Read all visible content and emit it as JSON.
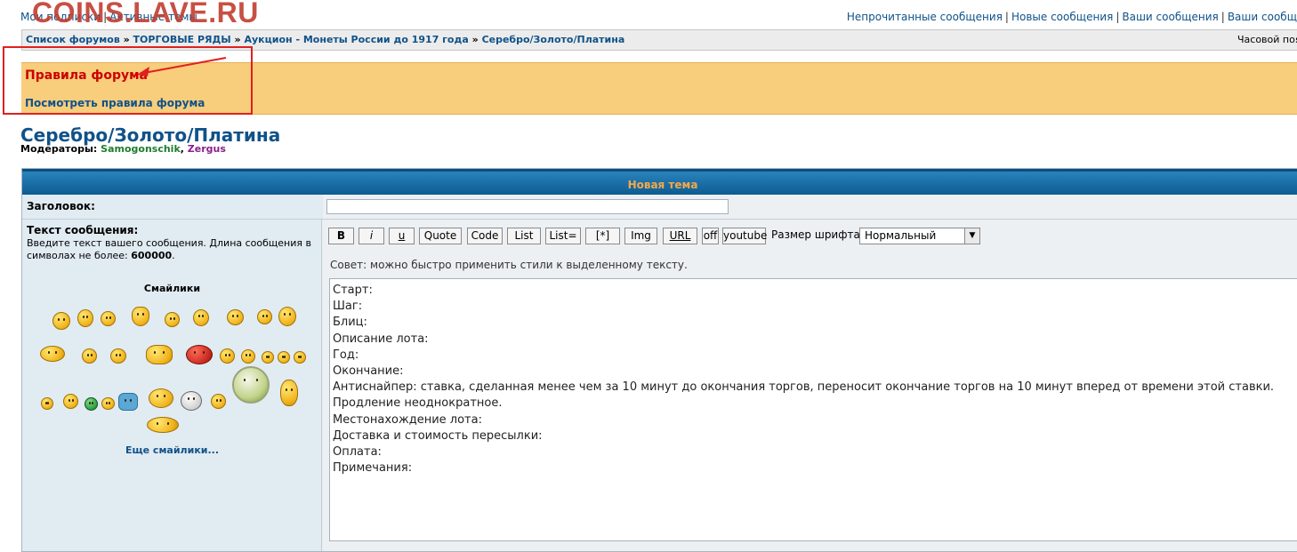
{
  "watermark": "COINS.LAVE.RU",
  "top_left_links": {
    "subscriptions": "Мои подписки",
    "active": "Активные темы"
  },
  "top_right_links": [
    "Непрочитанные сообщения",
    "Новые сообщения",
    "Ваши сообщения",
    "Ваши сообщ"
  ],
  "breadcrumbs": [
    "Список форумов",
    "ТОРГОВЫЕ РЯДЫ",
    "Аукцион - Монеты России до 1917 года",
    "Серебро/Золото/Платина"
  ],
  "timezone_text": "Часовой пояс",
  "rules": {
    "title": "Правила форума",
    "link": "Посмотреть правила форума"
  },
  "forum": {
    "title": "Серебро/Золото/Платина",
    "moderators_label": "Модераторы:",
    "moderators": [
      "Samogonschik",
      "Zergus"
    ]
  },
  "form": {
    "header": "Новая тема",
    "subject_label": "Заголовок:",
    "subject_value": "",
    "message_label": "Текст сообщения:",
    "message_desc": "Введите текст вашего сообщения. Длина сообщения в символах не более: ",
    "message_max": "600000",
    "smilies_title": "Смайлики",
    "more_smilies": "Еще смайлики...",
    "toolbar": [
      "B",
      "i",
      "u",
      "Quote",
      "Code",
      "List",
      "List=",
      "[*]",
      "Img",
      "URL",
      "off",
      "youtube"
    ],
    "font_size_label": "Размер шрифта:",
    "font_size_value": "Нормальный",
    "hint": "Совет: можно быстро применить стили к выделенному тексту.",
    "message_text": "Старт:\nШаг:\nБлиц:\nОписание лота:\nГод:\nОкончание:\nАнтиснайпер: ставка, сделанная менее чем за 10 минут до окончания торгов, переносит окончание торгов на 10 минут вперед от времени этой ставки.\nПродление неоднократное.\nМестонахождение лота:\nДоставка и стоимость пересылки:\nОплата:\nПримечания:"
  },
  "colors": {
    "accent": "#105289",
    "rules_bg": "#f8cd7c",
    "rules_title": "#cc0000",
    "header_bar": "#1873ab",
    "header_text": "#f5a84a"
  }
}
